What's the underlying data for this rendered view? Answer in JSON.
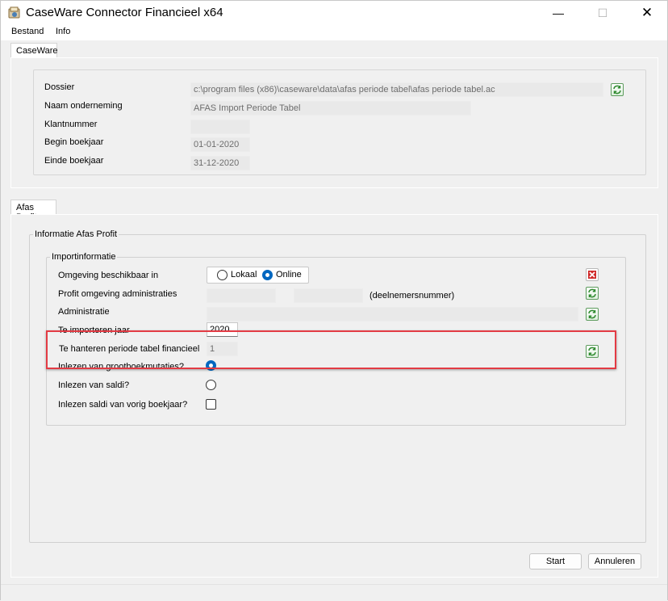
{
  "window": {
    "title": "CaseWare Connector Financieel x64",
    "minimize": "—",
    "maximize": "☐",
    "close": "✕"
  },
  "menu": [
    "Bestand",
    "Info"
  ],
  "caseware": {
    "tab": "CaseWare",
    "labels": {
      "dossier": "Dossier",
      "naam": "Naam onderneming",
      "klantnummer": "Klantnummer",
      "begin": "Begin boekjaar",
      "einde": "Einde boekjaar"
    },
    "values": {
      "dossier": "c:\\program files (x86)\\caseware\\data\\afas periode tabel\\afas periode tabel.ac",
      "naam": "AFAS Import Periode Tabel",
      "klantnummer": "",
      "begin": "01-01-2020",
      "einde": "31-12-2020"
    }
  },
  "afas": {
    "tab": "Afas Profit",
    "group_title": "Informatie Afas Profit",
    "import_title": "Importinformatie",
    "labels": {
      "omgeving": "Omgeving beschikbaar in",
      "profit_omgeving": "Profit omgeving administraties",
      "deelnemers": "(deelnemersnummer)",
      "administratie": "Administratie",
      "jaar": "Te importeren jaar",
      "periode": "Te hanteren periode tabel financieel",
      "grootboek": "Inlezen van grootboekmutaties?",
      "saldi": "Inlezen van saldi?",
      "saldi_vorig": "Inlezen saldi van vorig boekjaar?"
    },
    "options": {
      "lokaal": "Lokaal",
      "online": "Online"
    },
    "values": {
      "profit_omgeving": "",
      "deelnemersnummer": "",
      "administratie": "",
      "jaar": "2020",
      "periode": "1"
    },
    "selected_environment": "Online",
    "grootboek_selected": true,
    "saldi_selected": false,
    "saldi_vorig_checked": false
  },
  "buttons": {
    "start": "Start",
    "annuleren": "Annuleren"
  },
  "colors": {
    "highlight": "#e33b44",
    "accent": "#0067c0"
  }
}
